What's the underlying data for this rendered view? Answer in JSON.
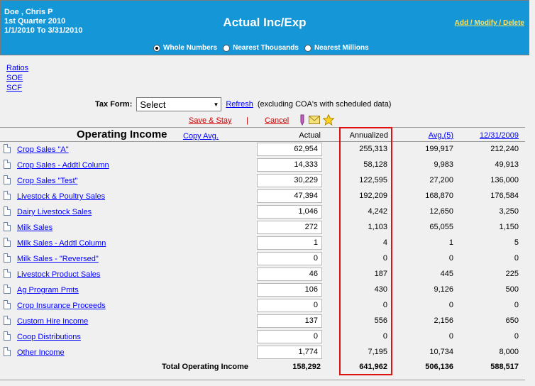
{
  "header": {
    "user_name": "Doe , Chris P",
    "period": "1st Quarter 2010",
    "date_range": "1/1/2010 To 3/31/2010",
    "title": "Actual Inc/Exp",
    "add_modify_delete": "Add / Modify / Delete",
    "colors": {
      "bar": "#1596d6",
      "link": "#ffe15a"
    }
  },
  "rounding": {
    "options": [
      "Whole Numbers",
      "Nearest Thousands",
      "Nearest Millions"
    ],
    "selected": "Whole Numbers"
  },
  "side_links": [
    "Ratios",
    "SOE",
    "SCF"
  ],
  "tax_form": {
    "label": "Tax Form:",
    "value": "Select",
    "refresh": "Refresh",
    "note": "(excluding COA's with scheduled data)"
  },
  "actions": {
    "save": "Save & Stay",
    "separator": "|",
    "cancel": "Cancel"
  },
  "section": {
    "title": "Operating Income",
    "copy_avg": "Copy Avg.",
    "columns": {
      "actual": "Actual",
      "annualized": "Annualized",
      "avg": "Avg.(5)",
      "date": "12/31/2009"
    }
  },
  "rows": [
    {
      "label": "Crop Sales \"A\"",
      "actual": "62,954",
      "annualized": "255,313",
      "avg": "199,917",
      "date": "212,240"
    },
    {
      "label": "Crop Sales - Addtl Column",
      "actual": "14,333",
      "annualized": "58,128",
      "avg": "9,983",
      "date": "49,913"
    },
    {
      "label": "Crop Sales \"Test\"",
      "actual": "30,229",
      "annualized": "122,595",
      "avg": "27,200",
      "date": "136,000"
    },
    {
      "label": "Livestock & Poultry Sales",
      "actual": "47,394",
      "annualized": "192,209",
      "avg": "168,870",
      "date": "176,584"
    },
    {
      "label": "Dairy Livestock Sales",
      "actual": "1,046",
      "annualized": "4,242",
      "avg": "12,650",
      "date": "3,250"
    },
    {
      "label": "Milk Sales",
      "actual": "272",
      "annualized": "1,103",
      "avg": "65,055",
      "date": "1,150"
    },
    {
      "label": "Milk Sales - Addtl Column",
      "actual": "1",
      "annualized": "4",
      "avg": "1",
      "date": "5"
    },
    {
      "label": "Milk Sales - \"Reversed\"",
      "actual": "0",
      "annualized": "0",
      "avg": "0",
      "date": "0"
    },
    {
      "label": "Livestock Product Sales",
      "actual": "46",
      "annualized": "187",
      "avg": "445",
      "date": "225"
    },
    {
      "label": "Ag Program Pmts",
      "actual": "106",
      "annualized": "430",
      "avg": "9,126",
      "date": "500"
    },
    {
      "label": "Crop Insurance Proceeds",
      "actual": "0",
      "annualized": "0",
      "avg": "0",
      "date": "0"
    },
    {
      "label": "Custom Hire Income",
      "actual": "137",
      "annualized": "556",
      "avg": "2,156",
      "date": "650"
    },
    {
      "label": "Coop Distributions",
      "actual": "0",
      "annualized": "0",
      "avg": "0",
      "date": "0"
    },
    {
      "label": "Other Income",
      "actual": "1,774",
      "annualized": "7,195",
      "avg": "10,734",
      "date": "8,000"
    }
  ],
  "total": {
    "label": "Total Operating Income",
    "actual": "158,292",
    "annualized": "641,962",
    "avg": "506,136",
    "date": "588,517"
  },
  "icons": [
    "pencil-icon",
    "envelope-icon",
    "star-icon"
  ],
  "highlight_color": "#e01010"
}
